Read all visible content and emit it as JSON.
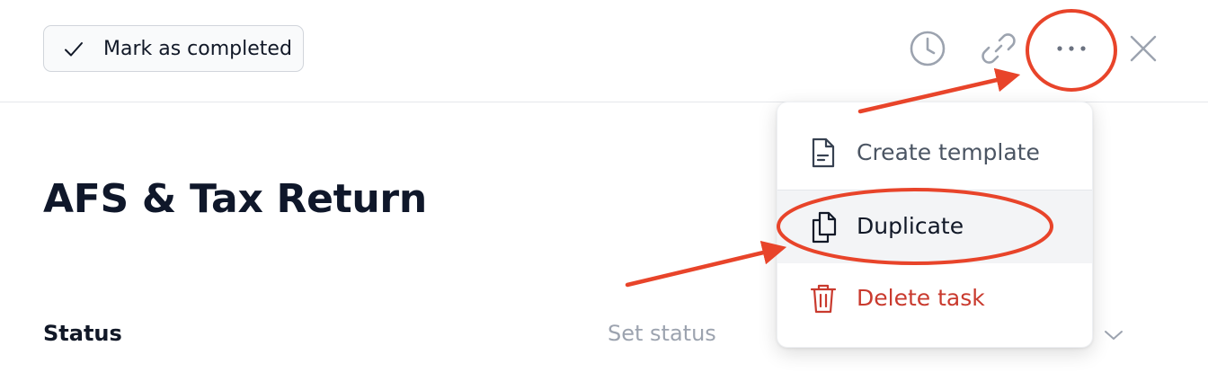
{
  "header": {
    "mark_completed_label": "Mark as completed",
    "icons": [
      "clock-icon",
      "link-icon",
      "more-icon",
      "close-icon"
    ]
  },
  "task": {
    "title": "AFS & Tax Return"
  },
  "fields": {
    "status_label": "Status",
    "status_placeholder": "Set status"
  },
  "menu": {
    "items": [
      {
        "label": "Create template",
        "icon": "document-icon"
      },
      {
        "label": "Duplicate",
        "icon": "copy-icon"
      },
      {
        "label": "Delete task",
        "icon": "trash-icon"
      }
    ]
  },
  "colors": {
    "annotation": "#e8442a",
    "danger": "#c93a2e",
    "muted_icon": "#9ca3af"
  }
}
